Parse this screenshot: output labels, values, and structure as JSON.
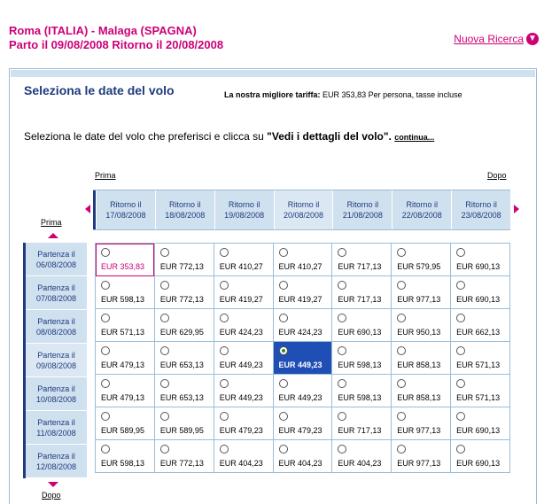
{
  "header": {
    "route": "Roma (ITALIA) - Malaga (SPAGNA)",
    "dates": "Parto il 09/08/2008 Ritorno il 20/08/2008",
    "new_search": "Nuova Ricerca"
  },
  "panel": {
    "title": "Seleziona le date del volo",
    "best_fare_label": "La nostra migliore tariffa:",
    "best_fare_value": "EUR 353,83 Per persona, tasse incluse",
    "instruction_text": "Seleziona le date del volo che preferisci e clicca su ",
    "instruction_bold": "\"Vedi i dettagli del volo\".",
    "continue_link": "continua..."
  },
  "nav": {
    "prima_top": "Prima",
    "dopo_top": "Dopo",
    "prima_left": "Prima",
    "dopo_bottom": "Dopo"
  },
  "returns": [
    "Ritorno il\n17/08/2008",
    "Ritorno il\n18/08/2008",
    "Ritorno il\n19/08/2008",
    "Ritorno il\n20/08/2008",
    "Ritorno il\n21/08/2008",
    "Ritorno il\n22/08/2008",
    "Ritorno il\n23/08/2008"
  ],
  "departures": [
    "Partenza il\n06/08/2008",
    "Partenza il\n07/08/2008",
    "Partenza il\n08/08/2008",
    "Partenza il\n09/08/2008",
    "Partenza il\n10/08/2008",
    "Partenza il\n11/08/2008",
    "Partenza il\n12/08/2008"
  ],
  "fares": [
    [
      "EUR 353,83",
      "EUR 772,13",
      "EUR 410,27",
      "EUR 410,27",
      "EUR 717,13",
      "EUR 579,95",
      "EUR 690,13"
    ],
    [
      "EUR 598,13",
      "EUR 772,13",
      "EUR 419,27",
      "EUR 419,27",
      "EUR 717,13",
      "EUR 977,13",
      "EUR 690,13"
    ],
    [
      "EUR 571,13",
      "EUR 629,95",
      "EUR 424,23",
      "EUR 424,23",
      "EUR 690,13",
      "EUR 950,13",
      "EUR 662,13"
    ],
    [
      "EUR 479,13",
      "EUR 653,13",
      "EUR 449,23",
      "EUR 449,23",
      "EUR 598,13",
      "EUR 858,13",
      "EUR 571,13"
    ],
    [
      "EUR 479,13",
      "EUR 653,13",
      "EUR 449,23",
      "EUR 449,23",
      "EUR 598,13",
      "EUR 858,13",
      "EUR 571,13"
    ],
    [
      "EUR 589,95",
      "EUR 589,95",
      "EUR 479,23",
      "EUR 479,23",
      "EUR 717,13",
      "EUR 977,13",
      "EUR 690,13"
    ],
    [
      "EUR 598,13",
      "EUR 772,13",
      "EUR 404,23",
      "EUR 404,23",
      "EUR 404,23",
      "EUR 977,13",
      "EUR 690,13"
    ]
  ],
  "selection": {
    "cheapest_row": 0,
    "cheapest_col": 0,
    "selected_row": 3,
    "selected_col": 3
  },
  "colors": {
    "accent": "#cc0077",
    "header_blue": "#1f3a7d",
    "selected_cell": "#1f4fb4",
    "grid_border": "#9bbcd6",
    "header_bg": "#cfe0ef"
  }
}
